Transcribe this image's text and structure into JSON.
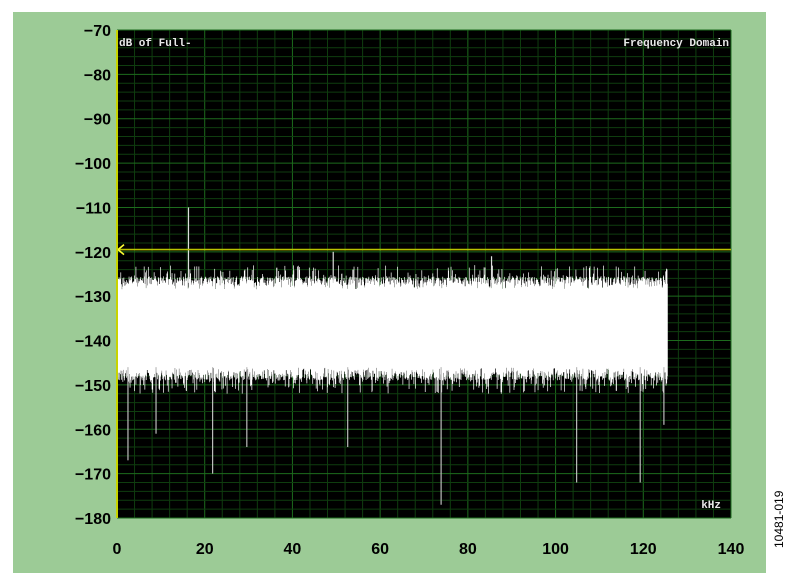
{
  "chart_data": {
    "type": "line",
    "title": "",
    "ylabel_corner": "dB of Full-",
    "panel_label": "Frequency Domain",
    "x_unit_label": "kHz",
    "xlim": [
      0,
      140
    ],
    "ylim": [
      -180,
      -70
    ],
    "x_ticks": [
      "0",
      "20",
      "40",
      "60",
      "80",
      "100",
      "120",
      "140"
    ],
    "y_ticks": [
      "−70",
      "−80",
      "−90",
      "−100",
      "−110",
      "−120",
      "−130",
      "−140",
      "−150",
      "−160",
      "−170",
      "−180"
    ],
    "grid": true,
    "marker_line_y": -119.5,
    "series": [
      {
        "noise_band": {
          "x_range": [
            0,
            125.5
          ],
          "upper_db": -127,
          "lower_db": -146,
          "peak_db": -123,
          "trough_db": -152
        },
        "spurs": [
          {
            "x": 16.3,
            "y": -110
          },
          {
            "x": 49.3,
            "y": -120
          },
          {
            "x": 85.4,
            "y": -121
          },
          {
            "x": 53.8,
            "y": -124
          },
          {
            "x": 2.5,
            "y": -167
          },
          {
            "x": 8.9,
            "y": -161
          },
          {
            "x": 21.8,
            "y": -170
          },
          {
            "x": 29.6,
            "y": -164
          },
          {
            "x": 52.6,
            "y": -164
          },
          {
            "x": 73.9,
            "y": -177
          },
          {
            "x": 104.8,
            "y": -172
          },
          {
            "x": 119.3,
            "y": -172
          },
          {
            "x": 124.7,
            "y": -159
          }
        ]
      }
    ]
  },
  "colors": {
    "frame": "#9ccb96",
    "plot_bg": "#000000",
    "grid_minor": "#0f3d0f",
    "grid_major": "#1d6b1d",
    "signal": "#ffffff",
    "marker_line": "#b8c200",
    "left_axis": "#c8d400"
  },
  "figure_id": "10481-019"
}
